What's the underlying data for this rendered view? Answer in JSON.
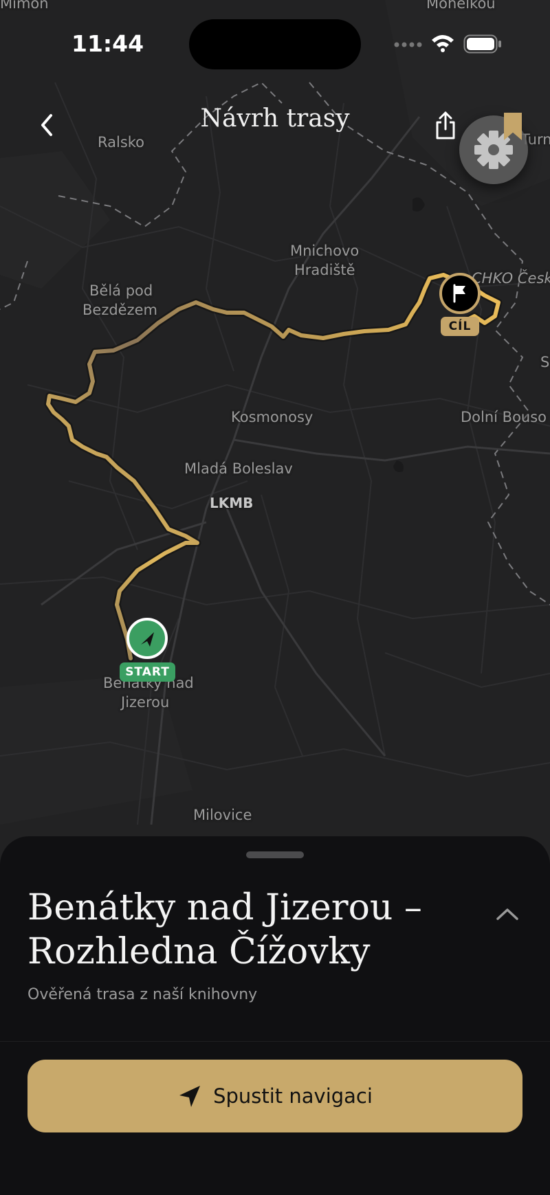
{
  "status_bar": {
    "time": "11:44"
  },
  "header": {
    "title": "Návrh trasy"
  },
  "map": {
    "places": {
      "mimon": "Mimoň",
      "mohelkou": "Mohelkou",
      "ralsko": "Ralsko",
      "turnov": "Turn",
      "mnichovo_1": "Mnichovo",
      "mnichovo_2": "Hradiště",
      "bela_1": "Bělá pod",
      "bela_2": "Bezdězem",
      "chko": "CHKO Český",
      "kosmonosy": "Kosmonosy",
      "dolni_bousov": "Dolní Bouso",
      "mlada_boleslav": "Mladá Boleslav",
      "lkmb": "LKMB",
      "benatky_1": "Benátky nad",
      "benatky_2": "Jizerou",
      "milovice": "Milovice",
      "s_edge": "S"
    },
    "start_label": "START",
    "end_label": "CÍL"
  },
  "sheet": {
    "title_line1": "Benátky nad Jizerou –",
    "title_line2": "Rozhledna Čížovky",
    "subtitle": "Ověřená trasa z naší knihovny",
    "cta_label": "Spustit navigaci"
  },
  "colors": {
    "accent": "#c8a96b",
    "start_green": "#3b9e61",
    "map_bg": "#222223",
    "sheet_bg": "#101012"
  }
}
